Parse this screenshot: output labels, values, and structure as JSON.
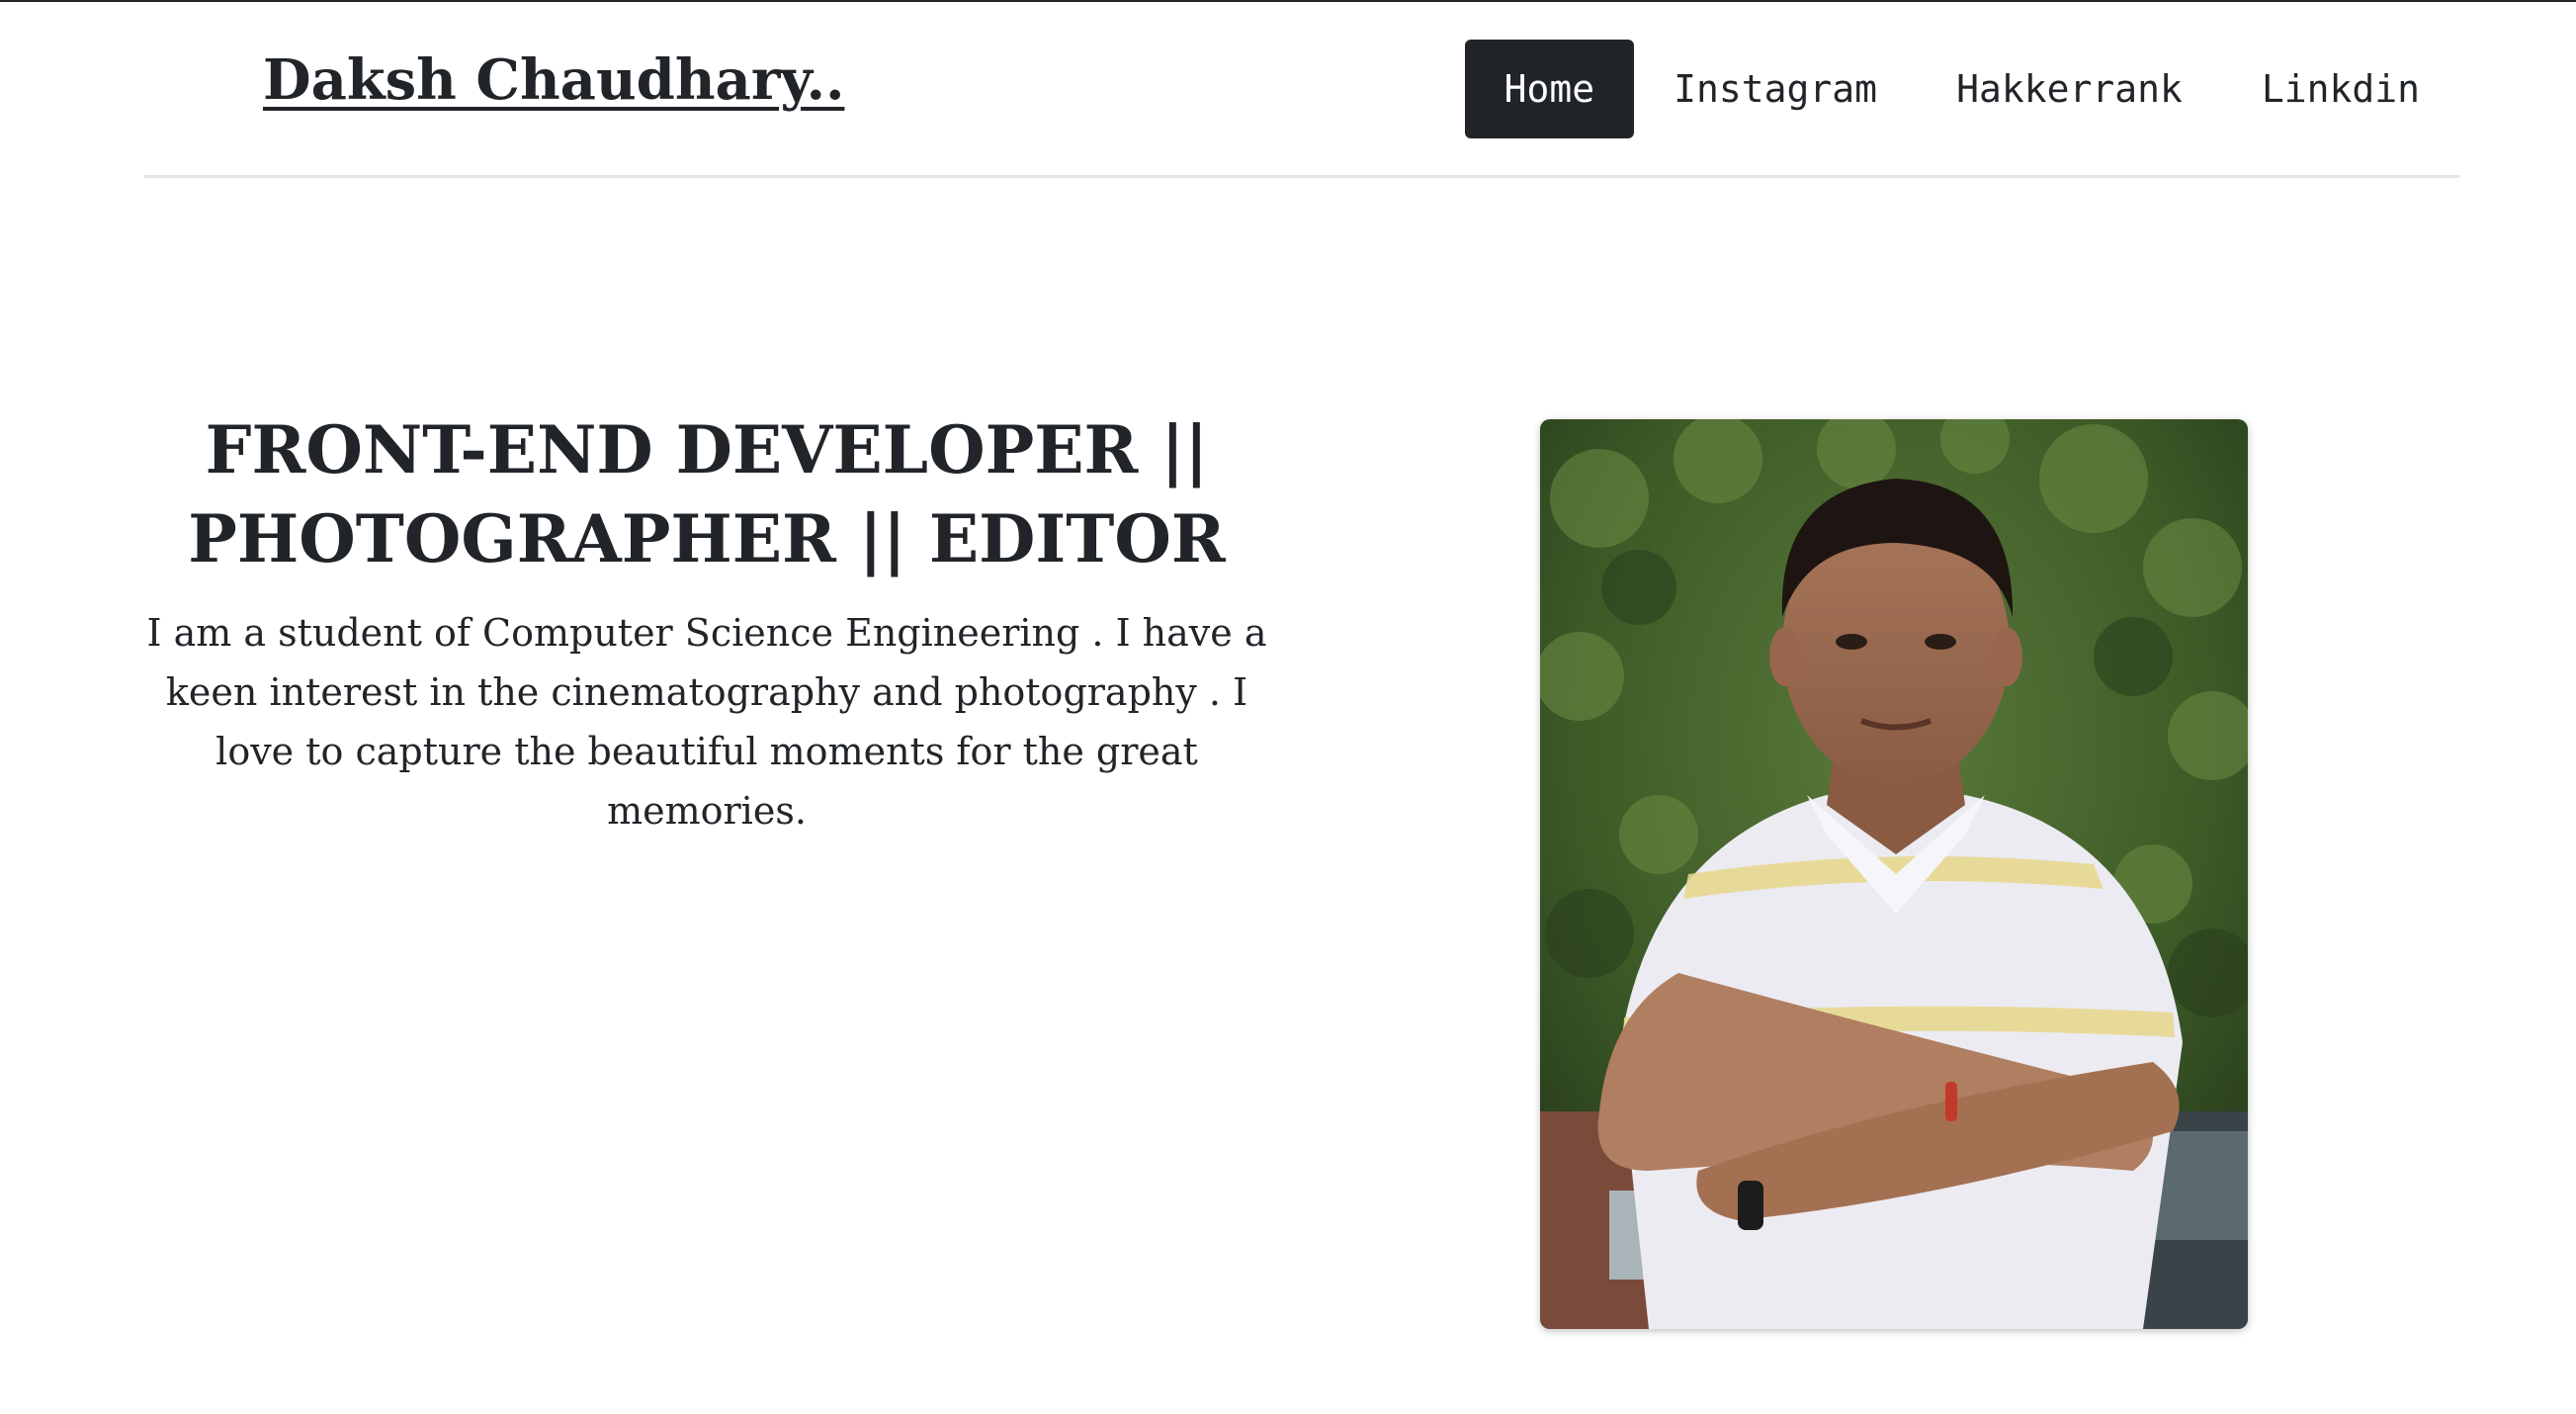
{
  "header": {
    "brand": "Daksh Chaudhary..",
    "nav": [
      {
        "label": "Home",
        "active": true
      },
      {
        "label": "Instagram",
        "active": false
      },
      {
        "label": "Hakkerrank",
        "active": false
      },
      {
        "label": "Linkdin",
        "active": false
      }
    ]
  },
  "hero": {
    "headline": "FRONT-END DEVELOPER || PHOTOGRAPHER || EDITOR",
    "bio": "I am a student of Computer Science Engineering . I have a keen interest in the cinematography and photography . I love to capture the beautiful moments for the great memories."
  },
  "colors": {
    "nav_active_bg": "#212529",
    "text": "#212529",
    "divider": "#e5e5e5"
  }
}
